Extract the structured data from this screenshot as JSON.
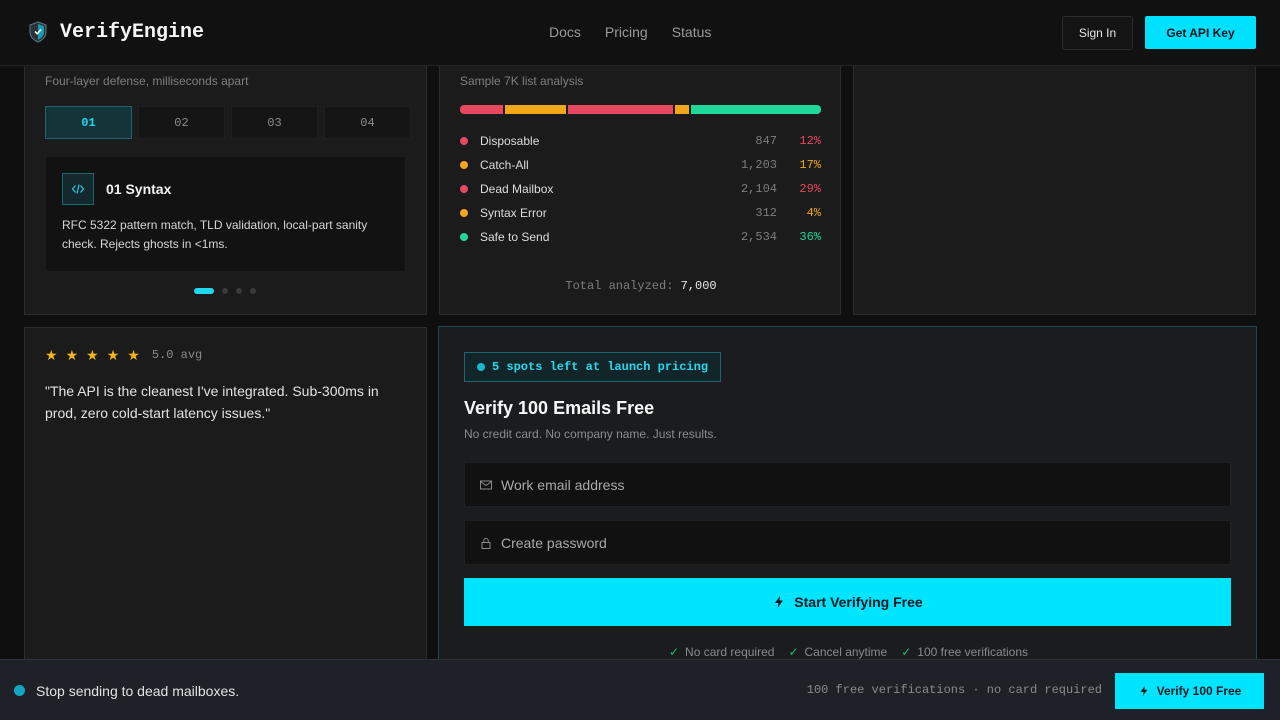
{
  "header": {
    "brand": "VerifyEngine",
    "nav": [
      "Docs",
      "Pricing",
      "Status"
    ],
    "sign_in": "Sign In",
    "get_api_key": "Get API Key"
  },
  "defense": {
    "subtitle": "Four-layer defense, milliseconds apart",
    "steps": [
      "01",
      "02",
      "03",
      "04"
    ],
    "active_step": "01",
    "card_title": "01 Syntax",
    "card_desc": "RFC 5322 pattern match, TLD validation, local-part sanity check. Rejects ghosts in <1ms.",
    "pagination_active_index": 0
  },
  "analysis": {
    "subtitle": "Sample 7K list analysis",
    "rows": [
      {
        "name": "Disposable",
        "count": "847",
        "pct": "12%",
        "color": "#e5485f",
        "value": 12
      },
      {
        "name": "Catch-All",
        "count": "1,203",
        "pct": "17%",
        "color": "#f0a81a",
        "value": 17
      },
      {
        "name": "Dead Mailbox",
        "count": "2,104",
        "pct": "29%",
        "color": "#e5485f",
        "value": 29
      },
      {
        "name": "Syntax Error",
        "count": "312",
        "pct": "4%",
        "color": "#f0a81a",
        "value": 4
      },
      {
        "name": "Safe to Send",
        "count": "2,534",
        "pct": "36%",
        "color": "#1fd89a",
        "value": 36
      }
    ],
    "total_label": "Total analyzed:",
    "total_value": "7,000"
  },
  "review": {
    "rating": 5,
    "avg": "5.0 avg",
    "quote": "\"The API is the cleanest I've integrated. Sub-300ms in prod, zero cold-start latency issues.\""
  },
  "signup": {
    "badge": "5 spots left at launch pricing",
    "title": "Verify 100 Emails Free",
    "subtitle": "No credit card. No company name. Just results.",
    "email_placeholder": "Work email address",
    "password_placeholder": "Create password",
    "cta": "Start Verifying Free",
    "perks": [
      "No card required",
      "Cancel anytime",
      "100 free verifications"
    ]
  },
  "sticky": {
    "message": "Stop sending to dead mailboxes.",
    "meta": "100 free verifications · no card required",
    "button": "Verify 100 Free"
  },
  "colors": {
    "accent": "#00e5ff",
    "danger": "#e5485f",
    "warning": "#f0a81a",
    "success": "#1fd89a"
  }
}
